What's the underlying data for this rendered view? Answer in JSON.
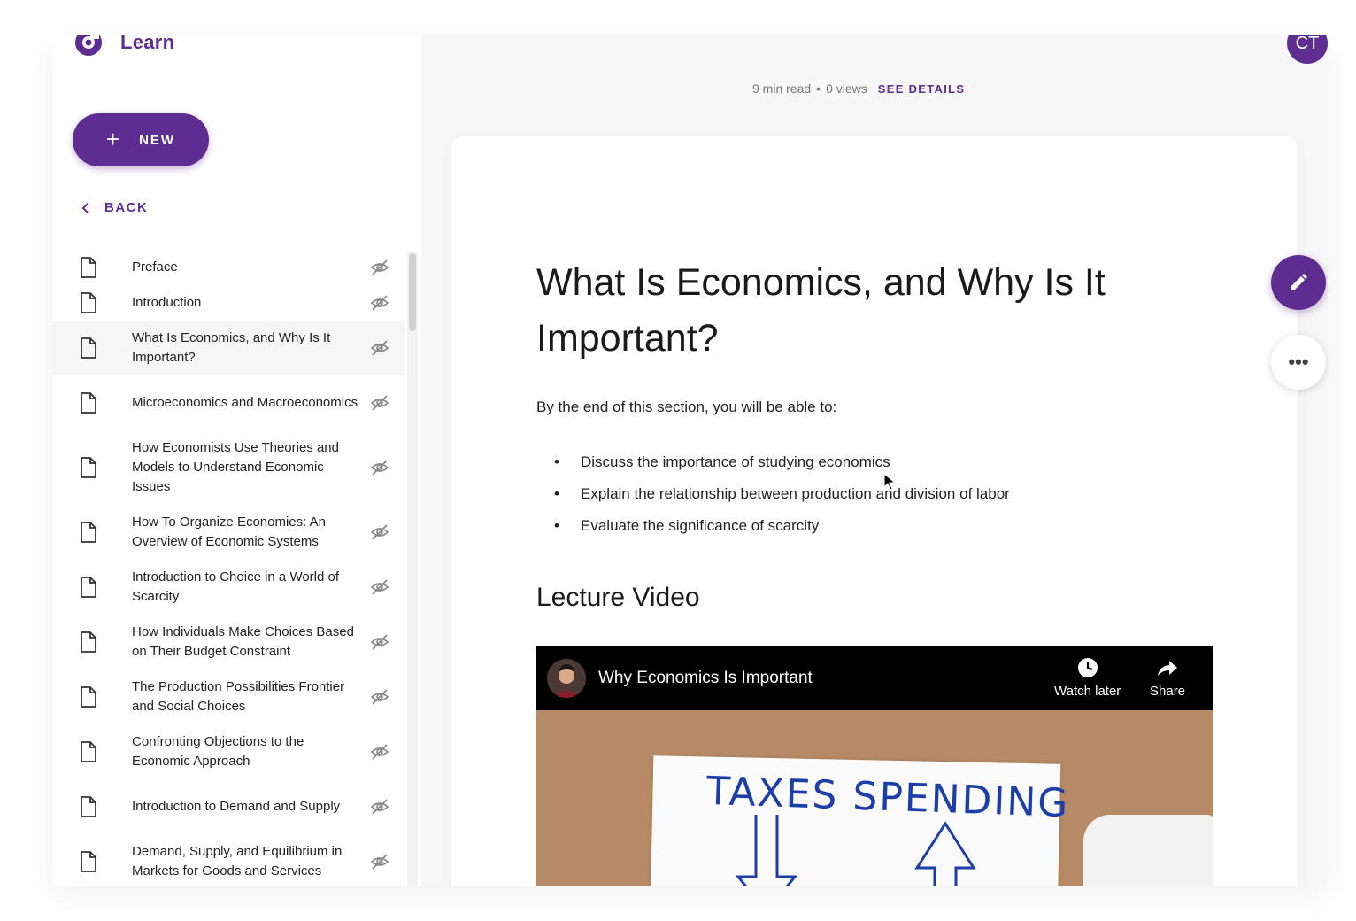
{
  "app": {
    "name": "Learn",
    "user_initials": "CT",
    "accent_color": "#5d2d91"
  },
  "sidebar": {
    "new_label": "NEW",
    "back_label": "BACK",
    "items": [
      {
        "label": "Preface",
        "active": false
      },
      {
        "label": "Introduction",
        "active": false
      },
      {
        "label": "What Is Economics, and Why Is It Important?",
        "active": true
      },
      {
        "label": "Microeconomics and Macroeconomics",
        "active": false
      },
      {
        "label": "How Economists Use Theories and Models to Understand Economic Issues",
        "active": false
      },
      {
        "label": "How To Organize Economies: An Overview of Economic Systems",
        "active": false
      },
      {
        "label": "Introduction to Choice in a World of Scarcity",
        "active": false
      },
      {
        "label": "How Individuals Make Choices Based on Their Budget Constraint",
        "active": false
      },
      {
        "label": "The Production Possibilities Frontier and Social Choices",
        "active": false
      },
      {
        "label": "Confronting Objections to the Economic Approach",
        "active": false
      },
      {
        "label": "Introduction to Demand and Supply",
        "active": false
      },
      {
        "label": "Demand, Supply, and Equilibrium in Markets for Goods and Services",
        "active": false
      }
    ]
  },
  "meta": {
    "read_time": "9 min read",
    "separator": "•",
    "views": "0 views",
    "details_label": "SEE DETAILS"
  },
  "content": {
    "title": "What Is Economics, and Why Is It Important?",
    "intro": "By the end of this section, you will be able to:",
    "objectives": [
      "Discuss the importance of studying economics",
      "Explain the relationship between production and division of labor",
      "Evaluate the significance of scarcity"
    ],
    "section_title": "Lecture Video",
    "video": {
      "title": "Why Economics Is Important",
      "watch_later": "Watch later",
      "share": "Share",
      "board_text": "TAXES SPENDING"
    }
  },
  "icons": {
    "logo": "learn-logo-icon",
    "new": "plus-icon",
    "back": "chevron-left-icon",
    "doc": "document-icon",
    "hidden": "eye-off-icon",
    "edit": "pencil-icon",
    "more": "more-horizontal-icon",
    "watch_later": "clock-icon",
    "share": "share-arrow-icon"
  }
}
